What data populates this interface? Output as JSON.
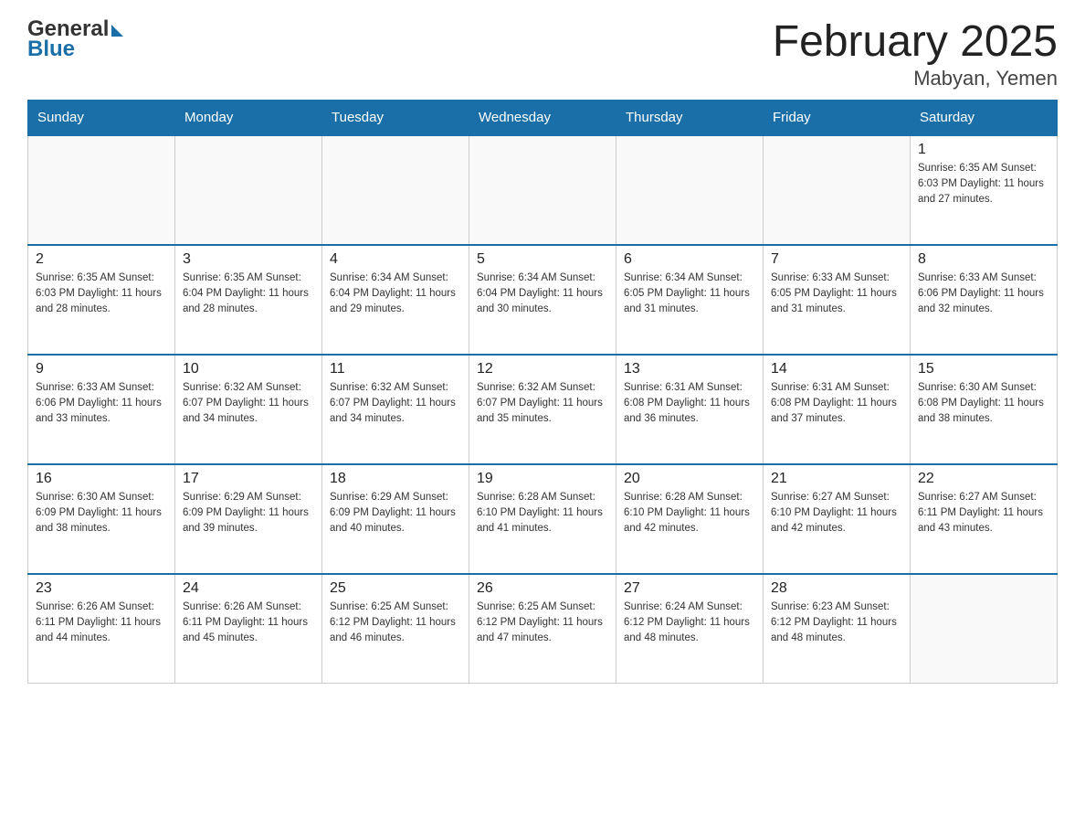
{
  "header": {
    "title": "February 2025",
    "subtitle": "Mabyan, Yemen",
    "logo_general": "General",
    "logo_blue": "Blue"
  },
  "weekdays": [
    "Sunday",
    "Monday",
    "Tuesday",
    "Wednesday",
    "Thursday",
    "Friday",
    "Saturday"
  ],
  "weeks": [
    [
      {
        "day": "",
        "info": ""
      },
      {
        "day": "",
        "info": ""
      },
      {
        "day": "",
        "info": ""
      },
      {
        "day": "",
        "info": ""
      },
      {
        "day": "",
        "info": ""
      },
      {
        "day": "",
        "info": ""
      },
      {
        "day": "1",
        "info": "Sunrise: 6:35 AM\nSunset: 6:03 PM\nDaylight: 11 hours\nand 27 minutes."
      }
    ],
    [
      {
        "day": "2",
        "info": "Sunrise: 6:35 AM\nSunset: 6:03 PM\nDaylight: 11 hours\nand 28 minutes."
      },
      {
        "day": "3",
        "info": "Sunrise: 6:35 AM\nSunset: 6:04 PM\nDaylight: 11 hours\nand 28 minutes."
      },
      {
        "day": "4",
        "info": "Sunrise: 6:34 AM\nSunset: 6:04 PM\nDaylight: 11 hours\nand 29 minutes."
      },
      {
        "day": "5",
        "info": "Sunrise: 6:34 AM\nSunset: 6:04 PM\nDaylight: 11 hours\nand 30 minutes."
      },
      {
        "day": "6",
        "info": "Sunrise: 6:34 AM\nSunset: 6:05 PM\nDaylight: 11 hours\nand 31 minutes."
      },
      {
        "day": "7",
        "info": "Sunrise: 6:33 AM\nSunset: 6:05 PM\nDaylight: 11 hours\nand 31 minutes."
      },
      {
        "day": "8",
        "info": "Sunrise: 6:33 AM\nSunset: 6:06 PM\nDaylight: 11 hours\nand 32 minutes."
      }
    ],
    [
      {
        "day": "9",
        "info": "Sunrise: 6:33 AM\nSunset: 6:06 PM\nDaylight: 11 hours\nand 33 minutes."
      },
      {
        "day": "10",
        "info": "Sunrise: 6:32 AM\nSunset: 6:07 PM\nDaylight: 11 hours\nand 34 minutes."
      },
      {
        "day": "11",
        "info": "Sunrise: 6:32 AM\nSunset: 6:07 PM\nDaylight: 11 hours\nand 34 minutes."
      },
      {
        "day": "12",
        "info": "Sunrise: 6:32 AM\nSunset: 6:07 PM\nDaylight: 11 hours\nand 35 minutes."
      },
      {
        "day": "13",
        "info": "Sunrise: 6:31 AM\nSunset: 6:08 PM\nDaylight: 11 hours\nand 36 minutes."
      },
      {
        "day": "14",
        "info": "Sunrise: 6:31 AM\nSunset: 6:08 PM\nDaylight: 11 hours\nand 37 minutes."
      },
      {
        "day": "15",
        "info": "Sunrise: 6:30 AM\nSunset: 6:08 PM\nDaylight: 11 hours\nand 38 minutes."
      }
    ],
    [
      {
        "day": "16",
        "info": "Sunrise: 6:30 AM\nSunset: 6:09 PM\nDaylight: 11 hours\nand 38 minutes."
      },
      {
        "day": "17",
        "info": "Sunrise: 6:29 AM\nSunset: 6:09 PM\nDaylight: 11 hours\nand 39 minutes."
      },
      {
        "day": "18",
        "info": "Sunrise: 6:29 AM\nSunset: 6:09 PM\nDaylight: 11 hours\nand 40 minutes."
      },
      {
        "day": "19",
        "info": "Sunrise: 6:28 AM\nSunset: 6:10 PM\nDaylight: 11 hours\nand 41 minutes."
      },
      {
        "day": "20",
        "info": "Sunrise: 6:28 AM\nSunset: 6:10 PM\nDaylight: 11 hours\nand 42 minutes."
      },
      {
        "day": "21",
        "info": "Sunrise: 6:27 AM\nSunset: 6:10 PM\nDaylight: 11 hours\nand 42 minutes."
      },
      {
        "day": "22",
        "info": "Sunrise: 6:27 AM\nSunset: 6:11 PM\nDaylight: 11 hours\nand 43 minutes."
      }
    ],
    [
      {
        "day": "23",
        "info": "Sunrise: 6:26 AM\nSunset: 6:11 PM\nDaylight: 11 hours\nand 44 minutes."
      },
      {
        "day": "24",
        "info": "Sunrise: 6:26 AM\nSunset: 6:11 PM\nDaylight: 11 hours\nand 45 minutes."
      },
      {
        "day": "25",
        "info": "Sunrise: 6:25 AM\nSunset: 6:12 PM\nDaylight: 11 hours\nand 46 minutes."
      },
      {
        "day": "26",
        "info": "Sunrise: 6:25 AM\nSunset: 6:12 PM\nDaylight: 11 hours\nand 47 minutes."
      },
      {
        "day": "27",
        "info": "Sunrise: 6:24 AM\nSunset: 6:12 PM\nDaylight: 11 hours\nand 48 minutes."
      },
      {
        "day": "28",
        "info": "Sunrise: 6:23 AM\nSunset: 6:12 PM\nDaylight: 11 hours\nand 48 minutes."
      },
      {
        "day": "",
        "info": ""
      }
    ]
  ]
}
